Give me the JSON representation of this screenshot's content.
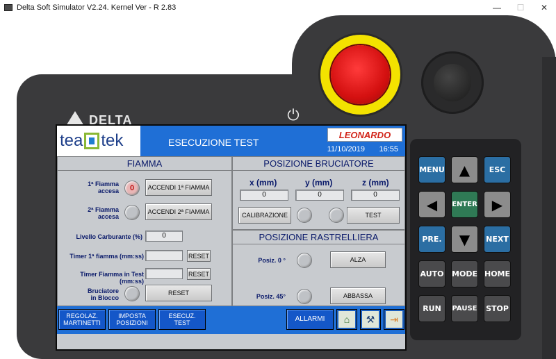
{
  "window": {
    "title": "Delta Soft Simulator V2.24. Kernel Ver - R 2.83",
    "minimize": "—",
    "maximize": "☐",
    "close": "✕"
  },
  "device": {
    "brand": "DELTA"
  },
  "header": {
    "logo_left": "tea",
    "logo_right": "tek",
    "title": "ESECUZIONE TEST",
    "brand": "LEONARDO",
    "date": "11/10/2019",
    "time": "16:55"
  },
  "fiamma": {
    "title": "FIAMMA",
    "label_1": "1ª Fiamma\naccesa",
    "lamp_1_value": "0",
    "button_1": "ACCENDI 1ª FIAMMA",
    "label_2": "2ª Fiamma\naccesa",
    "button_2": "ACCENDI 2ª FIAMMA",
    "fuel_label": "Livello Carburante (%)",
    "fuel_value": "0",
    "timer1_label": "Timer 1ª fiamma (mm:ss)",
    "timer1_value": "",
    "timer1_reset": "RESET",
    "timer2_label": "Timer Fiamma in Test (mm:ss)",
    "timer2_value": "",
    "timer2_reset": "RESET",
    "block_label": "Bruciatore\nin Blocco",
    "block_reset": "RESET"
  },
  "bruciatore": {
    "title": "POSIZIONE BRUCIATORE",
    "x_label": "x (mm)",
    "y_label": "y (mm)",
    "z_label": "z (mm)",
    "x_value": "0",
    "y_value": "0",
    "z_value": "0",
    "calibrazione": "CALIBRAZIONE",
    "test": "TEST"
  },
  "rastrelliera": {
    "title": "POSIZIONE RASTRELLIERA",
    "pos0_label": "Posiz. 0 °",
    "alza": "ALZA",
    "pos45_label": "Posiz. 45°",
    "abbassa": "ABBASSA"
  },
  "footer": {
    "regolaz": "REGOLAZ.\nMARTINETTI",
    "imposta": "IMPOSTA\nPOSIZIONI",
    "esecuz": "ESECUZ.\nTEST",
    "allarmi": "ALLARMI"
  },
  "keypad": {
    "menu": "MENU",
    "esc": "ESC",
    "enter": "ENTER",
    "pre": "PRE.",
    "next": "NEXT",
    "auto": "AUTO",
    "mode": "MODE",
    "home": "HOME",
    "run": "RUN",
    "pause": "PAUSE",
    "stop": "STOP"
  },
  "colors": {
    "header_blue": "#1f6fd6",
    "estop_yellow": "#f3e200",
    "estop_red": "#d41010",
    "key_blue": "#2b6ea3",
    "key_green": "#2f7a55"
  }
}
